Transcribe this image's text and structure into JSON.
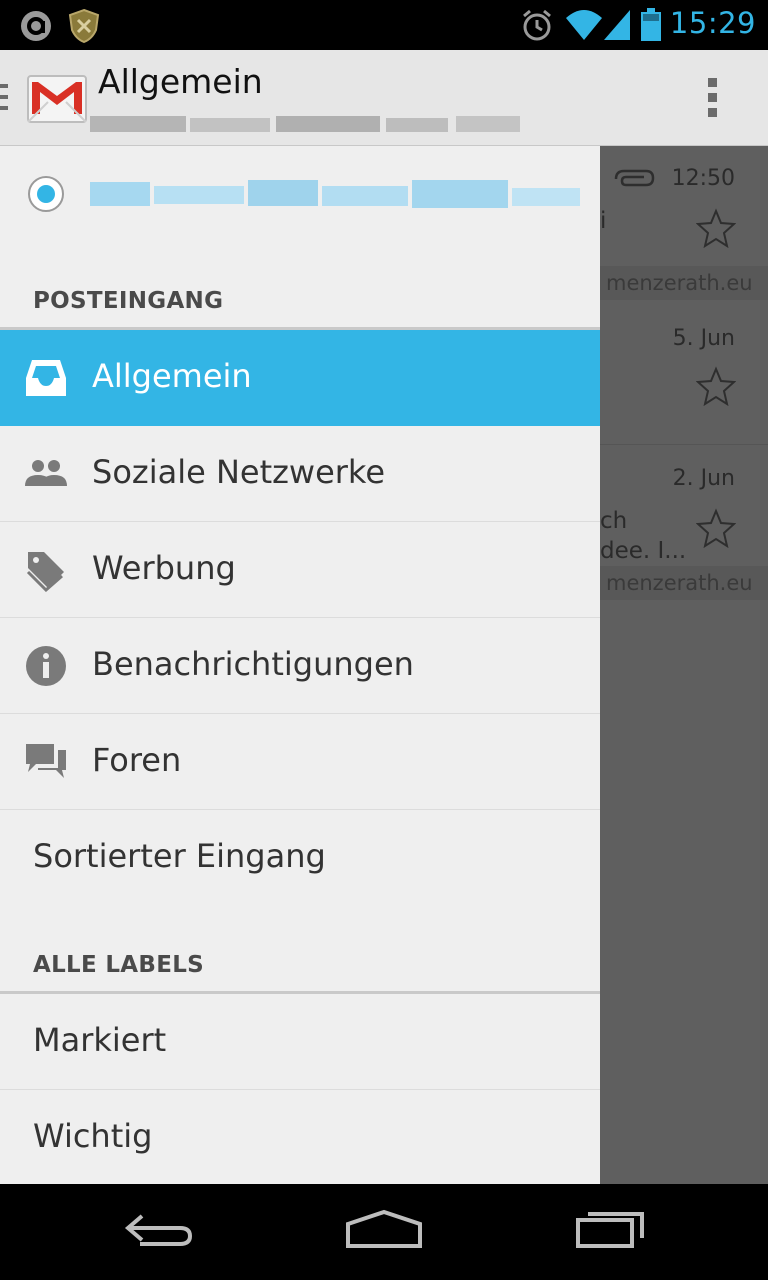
{
  "status_bar": {
    "time": "15:29",
    "icons": [
      "notification-a-icon",
      "shield-icon",
      "alarm-icon",
      "wifi-icon",
      "signal-icon",
      "battery-icon"
    ]
  },
  "action_bar": {
    "title": "Allgemein",
    "app_icon": "gmail-icon",
    "overflow_icon": "overflow-menu-icon"
  },
  "drawer": {
    "account_selected": true,
    "inbox_header": "POSTEINGANG",
    "inbox_items": [
      {
        "label": "Allgemein",
        "icon": "inbox-icon",
        "selected": true
      },
      {
        "label": "Soziale Netzwerke",
        "icon": "people-icon",
        "selected": false
      },
      {
        "label": "Werbung",
        "icon": "tag-icon",
        "selected": false
      },
      {
        "label": "Benachrichtigungen",
        "icon": "info-icon",
        "selected": false
      },
      {
        "label": "Foren",
        "icon": "forum-icon",
        "selected": false
      },
      {
        "label": "Sortierter Eingang",
        "icon": "",
        "selected": false
      }
    ],
    "labels_header": "ALLE LABELS",
    "label_items": [
      {
        "label": "Markiert"
      },
      {
        "label": "Wichtig"
      }
    ]
  },
  "mail_list": {
    "rows": [
      {
        "time": "12:50",
        "fragment": "i",
        "domain": "menzerath.eu",
        "has_attachment": true
      },
      {
        "time": "5. Jun",
        "fragment": "",
        "domain": "",
        "has_attachment": false
      },
      {
        "time": "2. Jun",
        "fragment": "ch",
        "fragment2": "dee. I...",
        "domain": "menzerath.eu",
        "has_attachment": false
      }
    ]
  },
  "colors": {
    "accent": "#33b5e5",
    "drawer_bg": "#efefef",
    "action_bar_bg": "#e6e6e6"
  }
}
